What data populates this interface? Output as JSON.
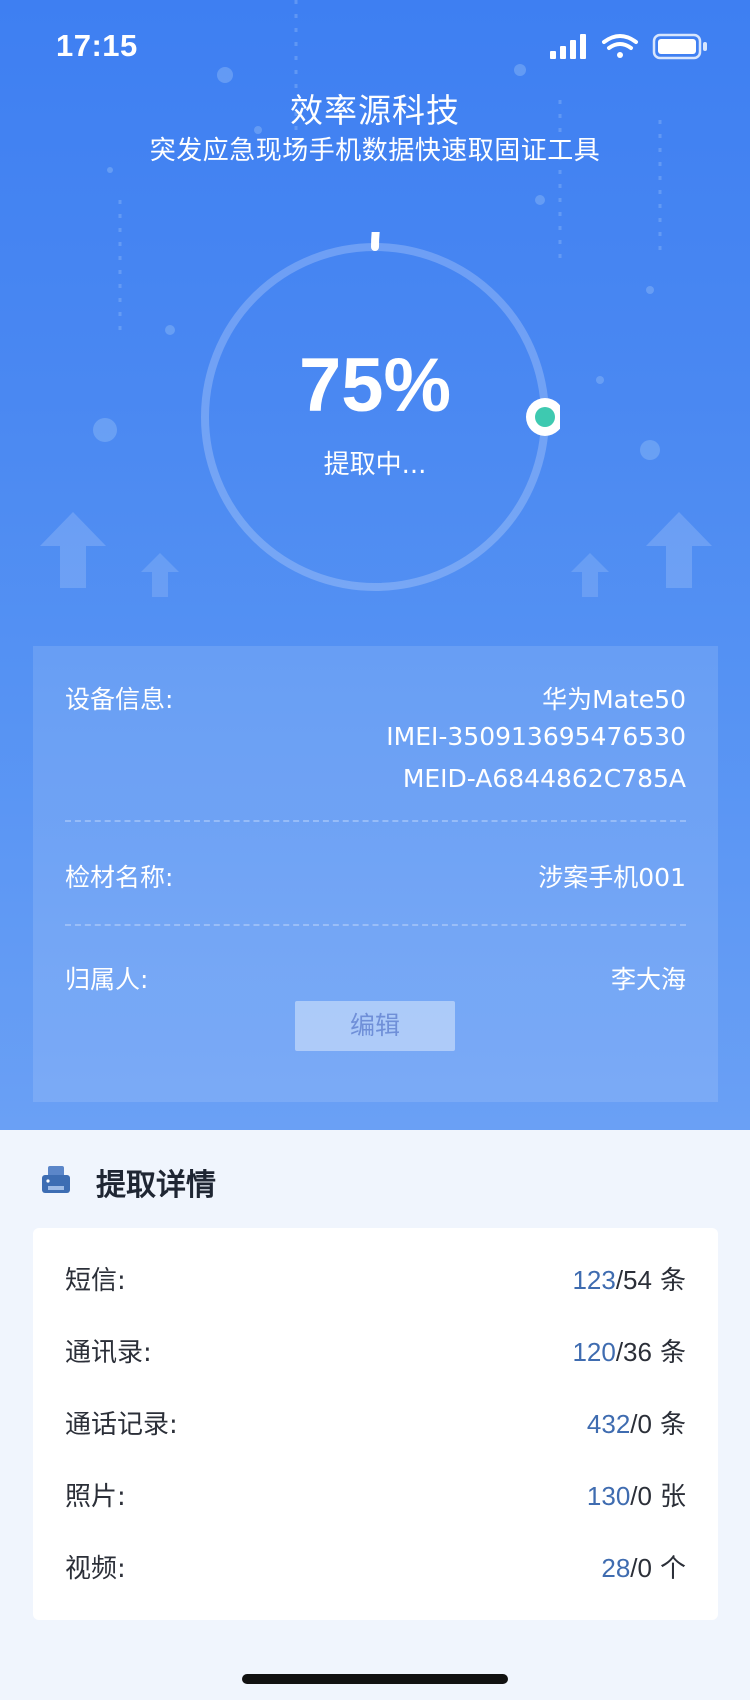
{
  "status_bar": {
    "time": "17:15",
    "icons": [
      "signal-icon",
      "wifi-icon",
      "battery-icon"
    ]
  },
  "header": {
    "title": "效率源科技",
    "subtitle": "突发应急现场手机数据快速取固证工具"
  },
  "progress": {
    "value_text": "75%",
    "fraction": 0.75,
    "status": "提取中..."
  },
  "device": {
    "info_label": "设备信息:",
    "model": "华为Mate50",
    "imei": "IMEI-350913695476530",
    "meid": "MEID-A6844862C785A",
    "material_label": "检材名称:",
    "material_value": "涉案手机001",
    "owner_label": "归属人:",
    "owner_value": "李大海",
    "edit_label": "编辑"
  },
  "details": {
    "title": "提取详情",
    "icon": "printer-icon",
    "items": [
      {
        "label": "短信:",
        "done": "123",
        "total": "/54",
        "unit": "条"
      },
      {
        "label": "通讯录:",
        "done": "120",
        "total": "/36",
        "unit": "条"
      },
      {
        "label": "通话记录:",
        "done": "432",
        "total": "/0",
        "unit": "条"
      },
      {
        "label": "照片:",
        "done": "130",
        "total": "/0",
        "unit": "张"
      },
      {
        "label": "视频:",
        "done": "28",
        "total": "/0",
        "unit": "个"
      }
    ]
  },
  "colors": {
    "accent": "#3e7ff2",
    "progress_dot": "#3ec9b0",
    "done_count": "#3f6cb0"
  }
}
